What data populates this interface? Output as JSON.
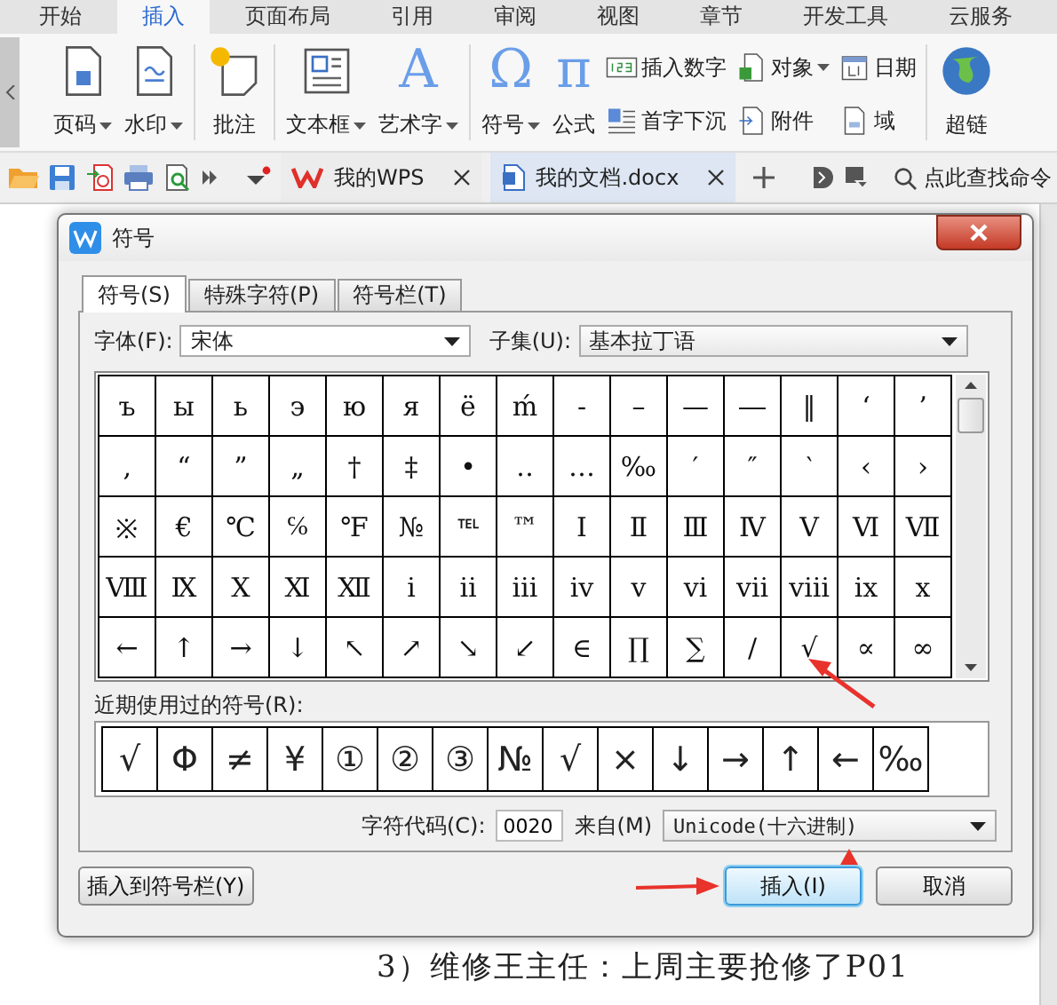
{
  "ribbon_tabs": [
    {
      "label": "开始",
      "selected": false
    },
    {
      "label": "插入",
      "selected": true
    },
    {
      "label": "页面布局",
      "selected": false
    },
    {
      "label": "引用",
      "selected": false
    },
    {
      "label": "审阅",
      "selected": false
    },
    {
      "label": "视图",
      "selected": false
    },
    {
      "label": "章节",
      "selected": false
    },
    {
      "label": "开发工具",
      "selected": false
    },
    {
      "label": "云服务",
      "selected": false
    }
  ],
  "ribbon_groups": [
    {
      "items": [
        {
          "kind": "large",
          "label": "页码",
          "dropdown": true
        },
        {
          "kind": "large",
          "label": "水印",
          "dropdown": true
        }
      ]
    },
    {
      "items": [
        {
          "kind": "large",
          "label": "批注",
          "dropdown": false
        }
      ]
    },
    {
      "items": [
        {
          "kind": "large",
          "label": "文本框",
          "dropdown": true
        },
        {
          "kind": "large",
          "label": "艺术字",
          "dropdown": true,
          "glyph": "A"
        }
      ]
    },
    {
      "items": [
        {
          "kind": "large",
          "label": "符号",
          "dropdown": true,
          "glyph": "Ω"
        },
        {
          "kind": "large",
          "label": "公式",
          "dropdown": false,
          "glyph": "π"
        },
        {
          "kind": "stack",
          "rows": [
            {
              "label": "插入数字",
              "dropdown": false
            },
            {
              "label": "首字下沉",
              "dropdown": false
            }
          ]
        },
        {
          "kind": "stack",
          "rows": [
            {
              "label": "对象",
              "dropdown": true
            },
            {
              "label": "附件",
              "dropdown": false
            }
          ]
        },
        {
          "kind": "stack",
          "rows": [
            {
              "label": "日期",
              "dropdown": false
            },
            {
              "label": "域",
              "dropdown": false
            }
          ]
        }
      ]
    },
    {
      "items": [
        {
          "kind": "large",
          "label": "超链",
          "dropdown": false
        }
      ]
    }
  ],
  "doc_tabs": [
    {
      "label": "我的WPS",
      "selected": false
    },
    {
      "label": "我的文档.docx",
      "selected": true
    }
  ],
  "command_search": {
    "placeholder": "点此查找命令"
  },
  "dialog": {
    "title": "符号",
    "tabs": [
      {
        "label": "符号(S)",
        "selected": true
      },
      {
        "label": "特殊字符(P)",
        "selected": false
      },
      {
        "label": "符号栏(T)",
        "selected": false
      }
    ],
    "font": {
      "label": "字体(F):",
      "value": "宋体"
    },
    "subset": {
      "label": "子集(U):",
      "value": "基本拉丁语"
    },
    "symbols": [
      [
        "ъ",
        "ы",
        "ь",
        "э",
        "ю",
        "я",
        "ё",
        "ḿ",
        "‐",
        "–",
        "—",
        "―",
        "‖",
        "‘",
        "’"
      ],
      [
        "‚",
        "“",
        "”",
        "„",
        "†",
        "‡",
        "•",
        "‥",
        "…",
        "‰",
        "′",
        "″",
        "‵",
        "‹",
        "›"
      ],
      [
        "※",
        "€",
        "℃",
        "℅",
        "℉",
        "№",
        "℡",
        "™",
        "Ⅰ",
        "Ⅱ",
        "Ⅲ",
        "Ⅳ",
        "Ⅴ",
        "Ⅵ",
        "Ⅶ"
      ],
      [
        "Ⅷ",
        "Ⅸ",
        "Ⅹ",
        "Ⅺ",
        "Ⅻ",
        "ⅰ",
        "ⅱ",
        "ⅲ",
        "ⅳ",
        "ⅴ",
        "ⅵ",
        "ⅶ",
        "ⅷ",
        "ⅸ",
        "ⅹ"
      ],
      [
        "←",
        "↑",
        "→",
        "↓",
        "↖",
        "↗",
        "↘",
        "↙",
        "∈",
        "∏",
        "∑",
        "∕",
        "√",
        "∝",
        "∞"
      ]
    ],
    "recent_label": "近期使用过的符号(R):",
    "recent": [
      "√",
      "Φ",
      "≠",
      "¥",
      "①",
      "②",
      "③",
      "№",
      "√",
      "×",
      "↓",
      "→",
      "↑",
      "←",
      "‰"
    ],
    "char_code": {
      "label": "字符代码(C):",
      "value": "0020"
    },
    "from": {
      "label": "来自(M)",
      "value": "Unicode(十六进制)"
    },
    "buttons": [
      {
        "label": "插入到符号栏(Y)",
        "default": false
      },
      {
        "label": "插入(I)",
        "default": true
      },
      {
        "label": "取消",
        "default": false
      }
    ]
  },
  "document_text": "3）维修王主任：上周主要抢修了P01"
}
